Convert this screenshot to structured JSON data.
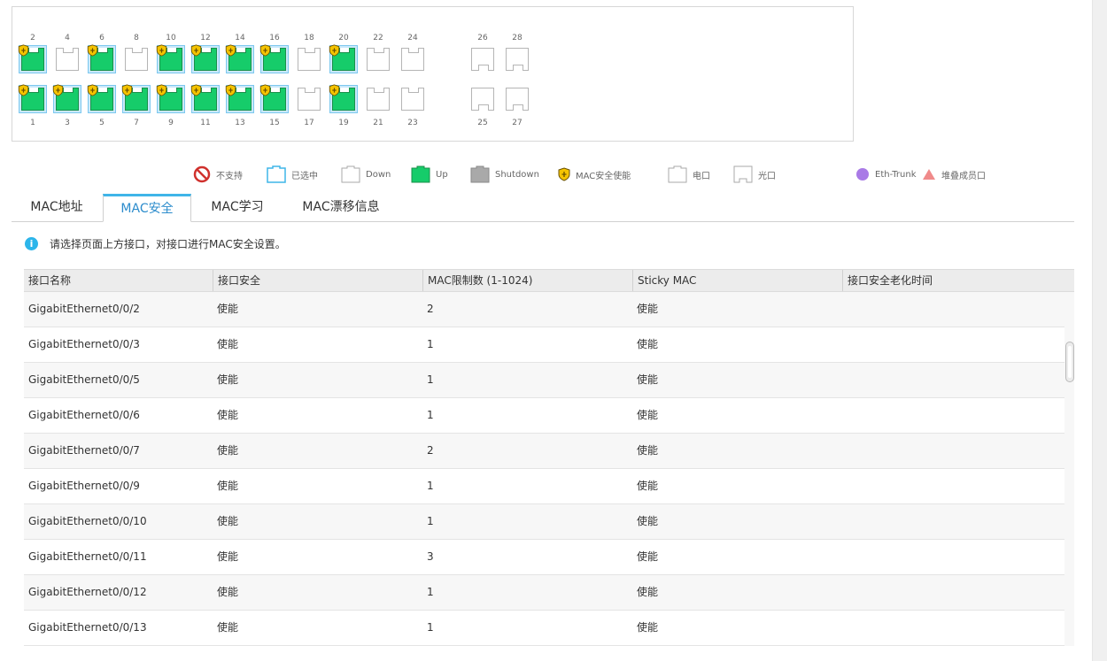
{
  "panel": {
    "top_ports": [
      {
        "num": "2",
        "state": "up",
        "mac_security": true
      },
      {
        "num": "4",
        "state": "down",
        "mac_security": false
      },
      {
        "num": "6",
        "state": "up",
        "mac_security": true
      },
      {
        "num": "8",
        "state": "down",
        "mac_security": false
      },
      {
        "num": "10",
        "state": "up",
        "mac_security": true
      },
      {
        "num": "12",
        "state": "up",
        "mac_security": true
      },
      {
        "num": "14",
        "state": "up",
        "mac_security": true
      },
      {
        "num": "16",
        "state": "up",
        "mac_security": true
      },
      {
        "num": "18",
        "state": "down",
        "mac_security": false
      },
      {
        "num": "20",
        "state": "up",
        "mac_security": true
      },
      {
        "num": "22",
        "state": "down",
        "mac_security": false
      },
      {
        "num": "24",
        "state": "down",
        "mac_security": false
      }
    ],
    "bottom_ports": [
      {
        "num": "1",
        "state": "up",
        "mac_security": true
      },
      {
        "num": "3",
        "state": "up",
        "mac_security": true
      },
      {
        "num": "5",
        "state": "up",
        "mac_security": true
      },
      {
        "num": "7",
        "state": "up",
        "mac_security": true
      },
      {
        "num": "9",
        "state": "up",
        "mac_security": true
      },
      {
        "num": "11",
        "state": "up",
        "mac_security": true
      },
      {
        "num": "13",
        "state": "up",
        "mac_security": true
      },
      {
        "num": "15",
        "state": "up",
        "mac_security": true
      },
      {
        "num": "17",
        "state": "down",
        "mac_security": false
      },
      {
        "num": "19",
        "state": "up",
        "mac_security": true
      },
      {
        "num": "21",
        "state": "down",
        "mac_security": false
      },
      {
        "num": "23",
        "state": "down",
        "mac_security": false
      }
    ],
    "fiber_top": [
      "26",
      "28"
    ],
    "fiber_bottom": [
      "25",
      "27"
    ]
  },
  "legend": {
    "unsupported": "不支持",
    "selected": "已选中",
    "down": "Down",
    "up": "Up",
    "shutdown": "Shutdown",
    "mac_security": "MAC安全使能",
    "electrical": "电口",
    "optical": "光口",
    "eth_trunk": "Eth-Trunk",
    "stack_member": "堆叠成员口"
  },
  "tabs": [
    {
      "label": "MAC地址",
      "active": false
    },
    {
      "label": "MAC安全",
      "active": true
    },
    {
      "label": "MAC学习",
      "active": false
    },
    {
      "label": "MAC漂移信息",
      "active": false
    }
  ],
  "info": {
    "icon": "info-icon",
    "text": "请选择页面上方接口，对接口进行MAC安全设置。"
  },
  "table": {
    "headers": [
      "接口名称",
      "接口安全",
      "MAC限制数 (1-1024)",
      "Sticky MAC",
      "接口安全老化时间"
    ],
    "rows": [
      [
        "GigabitEthernet0/0/2",
        "使能",
        "2",
        "使能",
        ""
      ],
      [
        "GigabitEthernet0/0/3",
        "使能",
        "1",
        "使能",
        ""
      ],
      [
        "GigabitEthernet0/0/5",
        "使能",
        "1",
        "使能",
        ""
      ],
      [
        "GigabitEthernet0/0/6",
        "使能",
        "1",
        "使能",
        ""
      ],
      [
        "GigabitEthernet0/0/7",
        "使能",
        "2",
        "使能",
        ""
      ],
      [
        "GigabitEthernet0/0/9",
        "使能",
        "1",
        "使能",
        ""
      ],
      [
        "GigabitEthernet0/0/10",
        "使能",
        "1",
        "使能",
        ""
      ],
      [
        "GigabitEthernet0/0/11",
        "使能",
        "3",
        "使能",
        ""
      ],
      [
        "GigabitEthernet0/0/12",
        "使能",
        "1",
        "使能",
        ""
      ],
      [
        "GigabitEthernet0/0/13",
        "使能",
        "1",
        "使能",
        ""
      ]
    ]
  },
  "colors": {
    "up": "#16cc6a",
    "accent": "#3fb5e8",
    "shutdown": "#a9a9a9",
    "shield": "#f5c400",
    "unsupported": "#d0312d",
    "eth_trunk": "#a97ae6",
    "stack": "#f08a8a"
  }
}
